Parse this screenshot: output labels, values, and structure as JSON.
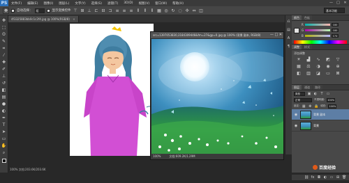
{
  "app": {
    "logo": "PS"
  },
  "menu": [
    "文件(F)",
    "编辑(E)",
    "图像(I)",
    "图层(L)",
    "文字(Y)",
    "选择(S)",
    "滤镜(T)",
    "3D(D)",
    "视图(V)",
    "窗口(W)",
    "帮助(H)"
  ],
  "window_controls": {
    "minimize": "—",
    "restore": "□",
    "close": "✕"
  },
  "options": {
    "auto_select_label": "自动选择：",
    "auto_select_target": "组",
    "show_transform_label": "显示变换控件",
    "workspace": "基本功能"
  },
  "tabs": [
    {
      "label": "4f3325883bb0c1c2f4.jpg @ 100%(RGB/8)",
      "close": "×"
    }
  ],
  "doc1": {
    "status": "100%  文档:203.6K/203.6K"
  },
  "doc2": {
    "title": "src=1397053830,3184309448&fm=27&gp=0.jpg @ 100% (背景 副本, RGB/8)",
    "buttons": "— □ ✕",
    "zoom": "100%",
    "doc_size": "文档:609.2K/1.29M"
  },
  "panels": {
    "color_tabs": [
      "颜色",
      "色板"
    ],
    "color": {
      "r_label": "R",
      "g_label": "G",
      "b_label": "B",
      "r": "180",
      "g": "180",
      "b": "174"
    },
    "adjust_tabs": [
      "调整",
      "样式"
    ],
    "adjust_title": "添加调整",
    "layers_tabs": [
      "图层",
      "通道",
      "路径"
    ],
    "layer_kind": "类型",
    "blend_mode": "正常",
    "opacity_label": "不透明度:",
    "opacity": "100%",
    "lock_label": "锁定:",
    "fill_label": "填充:",
    "fill": "100%",
    "layers": [
      {
        "name": "背景 副本",
        "active": true
      },
      {
        "name": "背景",
        "active": false
      }
    ]
  },
  "watermark": {
    "text": "百度经验"
  }
}
